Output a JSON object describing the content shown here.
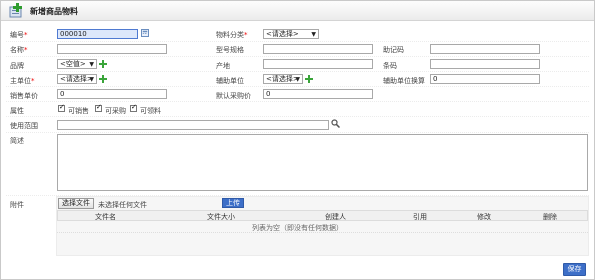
{
  "window": {
    "title": "新增商品物料"
  },
  "form": {
    "code": {
      "label": "编号",
      "value": "000010"
    },
    "category": {
      "label": "物料分类",
      "value": "<请选择>"
    },
    "name": {
      "label": "名称",
      "value": ""
    },
    "model": {
      "label": "型号规格",
      "value": ""
    },
    "mnemonic": {
      "label": "助记码",
      "value": ""
    },
    "brand": {
      "label": "品牌",
      "value": "<空值>"
    },
    "origin": {
      "label": "产地",
      "value": ""
    },
    "barcode": {
      "label": "条码",
      "value": ""
    },
    "main_unit": {
      "label": "主单位",
      "value": "<请选择>"
    },
    "aux_unit": {
      "label": "辅助单位",
      "value": "<请选择>"
    },
    "aux_conversion": {
      "label": "辅助单位换算",
      "value": "0"
    },
    "sale_price": {
      "label": "销售单价",
      "value": "0"
    },
    "default_purchase_price": {
      "label": "默认采购价",
      "value": "0"
    },
    "attributes": {
      "label": "属性",
      "options": [
        "可销售",
        "可采购",
        "可领料"
      ],
      "checked": [
        true,
        true,
        true
      ]
    },
    "scope": {
      "label": "使用范围",
      "value": ""
    },
    "description": {
      "label": "简述",
      "value": ""
    }
  },
  "attachments": {
    "label": "附件",
    "choose_file_label": "选择文件",
    "no_file_text": "未选择任何文件",
    "upload_label": "上传",
    "columns": [
      "文件名",
      "文件大小",
      "创建人",
      "引用",
      "修改",
      "删除"
    ],
    "empty_text": "列表为空（即没有任何数据）"
  },
  "footer": {
    "save_label": "保存"
  },
  "colors": {
    "accent": "#3d6fc8",
    "required": "#e00000",
    "plus_icon": "#3aa53a"
  },
  "icons": {
    "header": "new-item-icon",
    "add": "green-plus-icon",
    "calc": "calculator-icon",
    "search": "search-icon"
  }
}
